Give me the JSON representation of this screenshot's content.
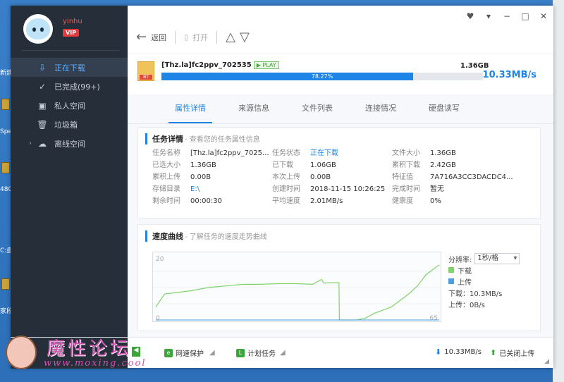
{
  "desktop": {
    "labels": [
      "新建",
      "Spe",
      "480",
      "C:盘",
      "家段"
    ]
  },
  "user": {
    "name": "yinhu",
    "vip": "VIP"
  },
  "sidebar": {
    "items": [
      {
        "label": "正在下载",
        "icon": "download-icon"
      },
      {
        "label": "已完成(99+)",
        "icon": "check-circle-icon"
      },
      {
        "label": "私人空间",
        "icon": "lock-icon"
      },
      {
        "label": "垃圾箱",
        "icon": "trash-icon"
      },
      {
        "label": "离线空间",
        "icon": "cloud-icon"
      }
    ]
  },
  "toolbar": {
    "back": "返回",
    "open": "打开"
  },
  "download": {
    "name": "[Thz.la]fc2ppv_702535",
    "play": "PLAY",
    "size": "1.36GB",
    "progress_text": "78.27%",
    "progress": 0.7827,
    "speed": "10.33MB/s",
    "file_badge": "BT"
  },
  "tabs": [
    "属性详情",
    "来源信息",
    "文件列表",
    "连接情况",
    "硬盘读写"
  ],
  "details": {
    "title": "任务详情",
    "subtitle": "- 查看您的任务属性信息",
    "rows": [
      [
        {
          "k": "任务名称",
          "v": "[Thz.la]fc2ppv_7025..."
        },
        {
          "k": "任务状态",
          "v": "正在下载",
          "blue": true
        },
        {
          "k": "文件大小",
          "v": "1.36GB"
        }
      ],
      [
        {
          "k": "已选大小",
          "v": "1.36GB"
        },
        {
          "k": "已下载",
          "v": "1.06GB"
        },
        {
          "k": "累积下载",
          "v": "2.42GB"
        }
      ],
      [
        {
          "k": "累积上传",
          "v": "0.00B"
        },
        {
          "k": "本次上传",
          "v": "0.00B"
        },
        {
          "k": "特征值",
          "v": "7A716A3CC3DACDC4..."
        }
      ],
      [
        {
          "k": "存储目录",
          "v": "E:\\",
          "blue": true
        },
        {
          "k": "创建时间",
          "v": "2018-11-15 10:26:25"
        },
        {
          "k": "完成时间",
          "v": "暂无"
        }
      ],
      [
        {
          "k": "剩余时间",
          "v": "00:00:30"
        },
        {
          "k": "平均速度",
          "v": "2.01MB/s"
        },
        {
          "k": "健康度",
          "v": "0%"
        }
      ]
    ]
  },
  "speed_curve": {
    "title": "速度曲线",
    "subtitle": "- 了解任务的速度走势曲线",
    "resolution_label": "分辨率:",
    "resolution_value": "1秒/格",
    "legend_download": "下载",
    "legend_upload": "上传",
    "download_readout": "下载：10.3MB/s",
    "upload_readout": "上传：0B/s",
    "colors": {
      "download": "#7ed36b",
      "upload": "#4a9fe8"
    }
  },
  "chart_data": {
    "type": "line",
    "ylim": [
      0,
      20
    ],
    "xlim": [
      0,
      65
    ],
    "tick_labels": {
      "y_top": "20",
      "y_bottom": "0",
      "x_right": "65"
    },
    "series": [
      {
        "name": "下载",
        "x": [
          0,
          2,
          5,
          8,
          12,
          16,
          20,
          24,
          28,
          32,
          36,
          38,
          38.6,
          39.3,
          40,
          41,
          42,
          42.1,
          42.2,
          46,
          48,
          50,
          52,
          54,
          56,
          58,
          60,
          62,
          64,
          65
        ],
        "values": [
          4,
          8,
          8.5,
          9,
          10,
          10.5,
          11,
          11,
          11.2,
          11.2,
          11,
          12.5,
          11.3,
          11.5,
          11.5,
          11.5,
          11.5,
          0,
          0,
          0,
          0.5,
          2,
          3,
          4,
          6,
          8,
          10.5,
          14,
          16,
          17
        ]
      },
      {
        "name": "上传",
        "x": [
          0,
          65
        ],
        "values": [
          0,
          0
        ]
      }
    ]
  },
  "statusbar": {
    "protect": "网速保护",
    "schedule": "计划任务",
    "down_speed": "10.33MB/s",
    "upload_status": "已关闭上传"
  },
  "watermark": {
    "text": "魔性论坛",
    "url": "www.moxing.cool"
  }
}
